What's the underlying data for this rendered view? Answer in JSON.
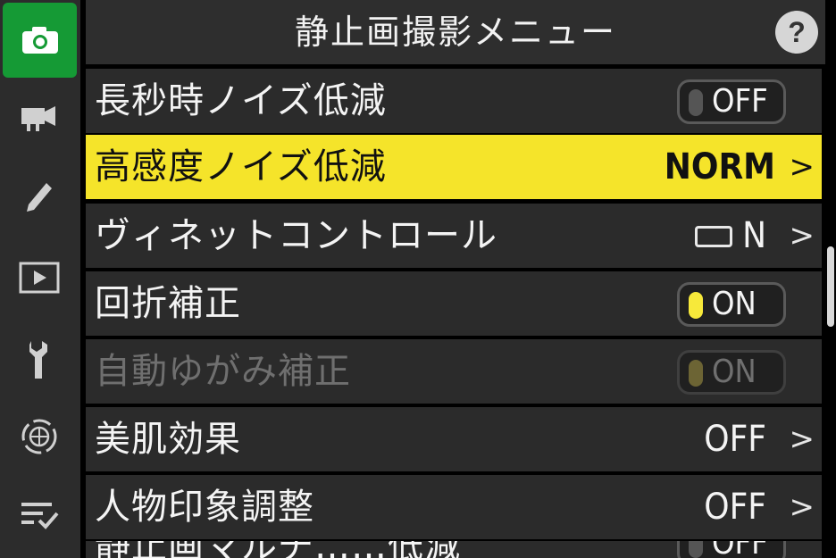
{
  "header": {
    "title": "静止画撮影メニュー",
    "help": "?"
  },
  "sidebar": {
    "items": [
      {
        "icon": "camera-icon",
        "active": true
      },
      {
        "icon": "movie-camera-icon"
      },
      {
        "icon": "pencil-icon"
      },
      {
        "icon": "playback-icon"
      },
      {
        "icon": "wrench-icon"
      },
      {
        "icon": "network-icon"
      },
      {
        "icon": "my-menu-icon"
      }
    ]
  },
  "menu": {
    "rows": [
      {
        "label": "長秒時ノイズ低減",
        "value": "OFF",
        "type": "toggle-off"
      },
      {
        "label": "高感度ノイズ低減",
        "value": "NORM",
        "type": "value",
        "selected": true
      },
      {
        "label": "ヴィネットコントロール",
        "value": "N",
        "type": "vignette"
      },
      {
        "label": "回折補正",
        "value": "ON",
        "type": "toggle-on"
      },
      {
        "label": "自動ゆがみ補正",
        "value": "ON",
        "type": "toggle-disabled",
        "disabled": true
      },
      {
        "label": "美肌効果",
        "value": "OFF",
        "type": "value"
      },
      {
        "label": "人物印象調整",
        "value": "OFF",
        "type": "value"
      },
      {
        "label": "静止画マルチ……低減",
        "value": "OFF",
        "type": "toggle-off",
        "partial": true
      }
    ],
    "chevron": ">"
  },
  "colors": {
    "accent": "#159a35",
    "highlight": "#f5e42a",
    "on": "#f7e93a"
  }
}
